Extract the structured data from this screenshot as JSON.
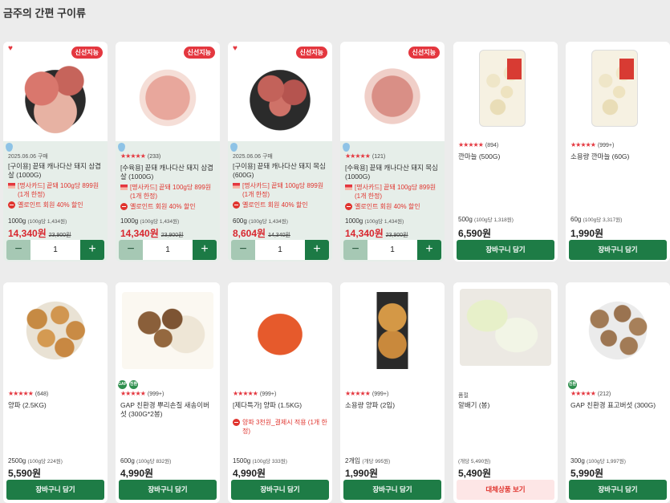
{
  "section_title": "금주의 간편 구이류",
  "row1": [
    {
      "badge": "신선지능",
      "date": "2025.06.06 구매",
      "name": "[구이용] 끝돼 캐나다산 돼지 삼겹살 (1000G)",
      "promo1": "[명사카드] 끝돼 100g당 899원 (1개 한정)",
      "promo2": "옐로인트 회원 40% 할인",
      "unit": "1000g",
      "unit_note": "(100g당 1,434원)",
      "price": "14,340원",
      "orig": "23,900원",
      "qty": "1"
    },
    {
      "badge": "신선지능",
      "stars": "★★★★★",
      "rating": "(233)",
      "name": "[수육용] 끝돼 캐나다산 돼지 삼겹살 (1000G)",
      "promo1": "[명사카드] 끝돼 100g당 899원 (1개 한정)",
      "promo2": "옐로인트 회원 40% 할인",
      "unit": "1000g",
      "unit_note": "(100g당 1,434원)",
      "price": "14,340원",
      "orig": "23,900원",
      "qty": "1"
    },
    {
      "badge": "신선지능",
      "date": "2025.06.06 구매",
      "name": "[구이용] 끝돼 캐나다산 돼지 목심 (600G)",
      "promo1": "[명사카드] 끝돼 100g당 899원 (1개 한정)",
      "promo2": "옐로인트 회원 40% 할인",
      "unit": "600g",
      "unit_note": "(100g당 1,434원)",
      "price": "8,604원",
      "orig": "14,340원",
      "qty": "1"
    },
    {
      "badge": "신선지능",
      "stars": "★★★★★",
      "rating": "(121)",
      "name": "[수육용] 끝돼 캐나다산 돼지 목심 (1000G)",
      "promo1": "[명사카드] 끝돼 100g당 899원 (1개 한정)",
      "promo2": "옐로인트 회원 40% 할인",
      "unit": "1000g",
      "unit_note": "(100g당 1,434원)",
      "price": "14,340원",
      "orig": "23,900원",
      "qty": "1"
    },
    {
      "stars": "★★★★★",
      "rating": "(894)",
      "name": "깐마늘 (500G)",
      "unit": "500g",
      "unit_note": "(100g당 1,318원)",
      "price": "6,590원",
      "cart": "장바구니 담기"
    },
    {
      "stars": "★★★★★",
      "rating": "(999+)",
      "name": "소용량 깐마늘 (60G)",
      "unit": "60g",
      "unit_note": "(100g당 3,317원)",
      "price": "1,990원",
      "cart": "장바구니 담기"
    }
  ],
  "row2": [
    {
      "stars": "★★★★★",
      "rating": "(648)",
      "name": "양파 (2.5KG)",
      "unit": "2500g",
      "unit_note": "(100g당 224원)",
      "price": "5,590원",
      "cart": "장바구니 담기"
    },
    {
      "stars": "★★★★★",
      "rating": "(999+)",
      "name": "GAP 친환경 뿌리손질 새송이버섯 (300G*2봉)",
      "unit": "600g",
      "unit_note": "(100g당 832원)",
      "price": "4,990원",
      "cart": "장바구니 담기"
    },
    {
      "stars": "★★★★★",
      "rating": "(999+)",
      "name": "[제다특가] 양파 (1.5KG)",
      "promo": "양파 3천원_결제시 적용 (1개 한정)",
      "unit": "1500g",
      "unit_note": "(100g당 333원)",
      "price": "4,990원",
      "cart": "장바구니 담기"
    },
    {
      "stars": "★★★★★",
      "rating": "(999+)",
      "name": "소용량 양파 (2입)",
      "unit": "2개입",
      "unit_note": "(개당 995원)",
      "price": "1,990원",
      "cart": "장바구니 담기"
    },
    {
      "date": "품절",
      "name": "알배기 (봉)",
      "unit": "",
      "unit_note": "(개당 5,490원)",
      "price": "5,490원",
      "cart": "대체상품 보기"
    },
    {
      "stars": "★★★★★",
      "rating": "(212)",
      "name": "GAP 친환경 표고버섯 (300G)",
      "unit": "300g",
      "unit_note": "(100g당 1,997원)",
      "price": "5,990원",
      "cart": "장바구니 담기"
    }
  ],
  "colors": {
    "accent_green": "#1e7c46",
    "accent_red": "#e4373f"
  }
}
